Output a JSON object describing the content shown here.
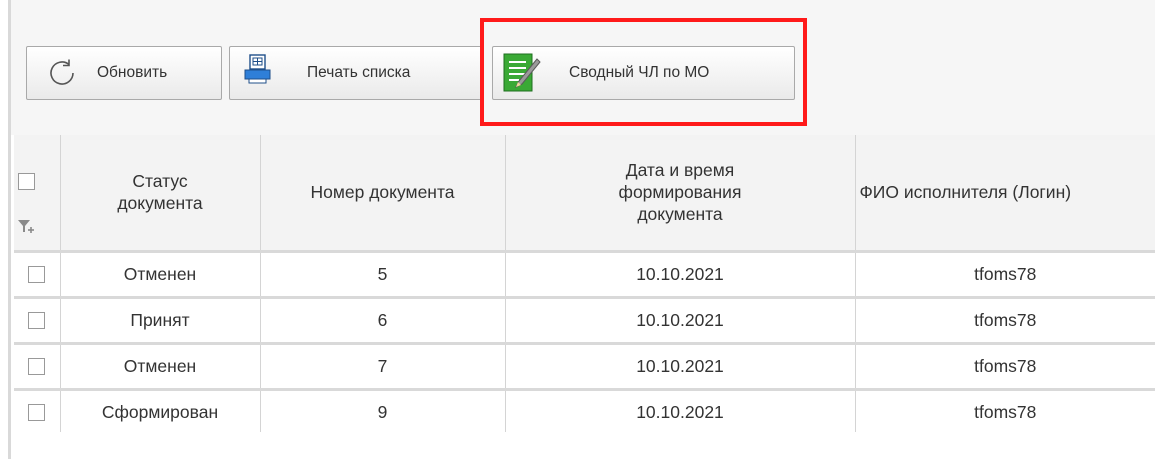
{
  "toolbar": {
    "refresh_label": "Обновить",
    "print_label": "Печать списка",
    "summary_label": "Сводный ЧЛ по МО"
  },
  "highlight_color": "#ff1a1a",
  "table": {
    "columns": [
      "Статус документа",
      "Номер документа",
      "Дата и время формирования документа",
      "ФИО исполнителя (Логин)"
    ],
    "rows": [
      {
        "status": "Отменен",
        "number": "5",
        "date": "10.10.2021",
        "login": "tfoms78"
      },
      {
        "status": "Принят",
        "number": "6",
        "date": "10.10.2021",
        "login": "tfoms78"
      },
      {
        "status": "Отменен",
        "number": "7",
        "date": "10.10.2021",
        "login": "tfoms78"
      },
      {
        "status": "Сформирован",
        "number": "9",
        "date": "10.10.2021",
        "login": "tfoms78"
      }
    ]
  },
  "icons": [
    "refresh-icon",
    "printer-icon",
    "document-edit-icon",
    "add-filter-icon"
  ]
}
